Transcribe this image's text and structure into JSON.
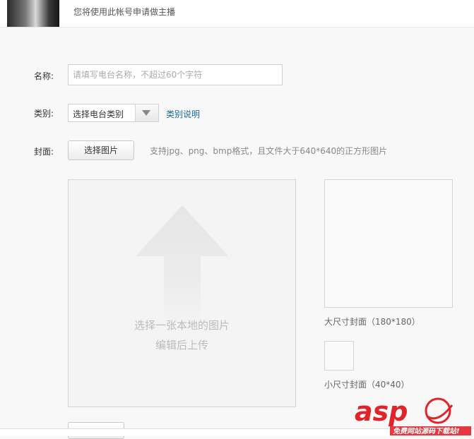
{
  "topbar": {
    "notice": "您将使用此帐号申请做主播"
  },
  "form": {
    "name_label": "名称:",
    "name_placeholder": "请填写电台名称，不超过60个字符",
    "category_label": "类别:",
    "category_selected": "选择电台类别",
    "category_help_link": "类别说明",
    "cover_label": "封面:",
    "choose_image_button": "选择图片",
    "cover_hint": "支持jpg、png、bmp格式，且文件大于640*640的正方形图片"
  },
  "upload": {
    "line1": "选择一张本地的图片",
    "line2": "编辑后上传"
  },
  "preview": {
    "large_label": "大尺寸封面（180*180）",
    "small_label": "小尺寸封面（40*40）"
  },
  "watermark": {
    "text": "asp",
    "subtext": "免费网站源码下载站!"
  },
  "colors": {
    "page_background": "#f8f8f8",
    "link": "#1e6a9b",
    "watermark_red": "#e0242a"
  }
}
